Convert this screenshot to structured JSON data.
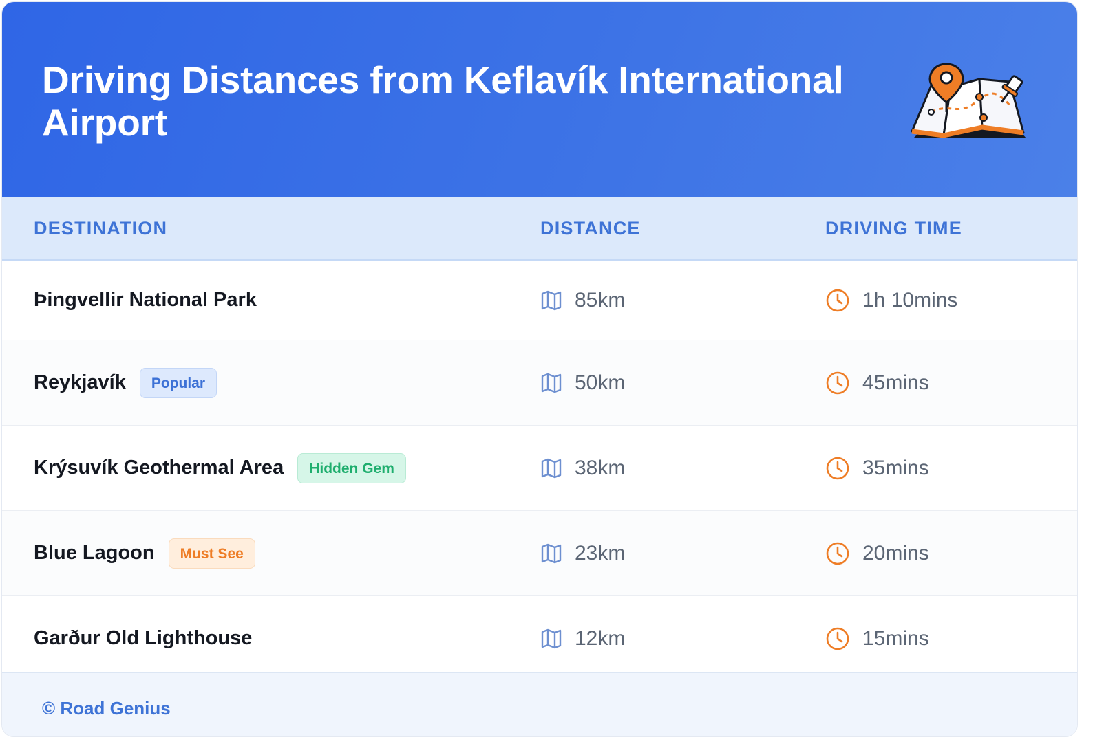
{
  "header": {
    "title": "Driving Distances from Keflavík International Airport",
    "illustration": "map-with-pins-icon"
  },
  "columns": {
    "destination": "DESTINATION",
    "distance": "DISTANCE",
    "driving_time": "DRIVING TIME"
  },
  "rows": [
    {
      "destination": "Þingvellir National Park",
      "badge": "",
      "distance": "85km",
      "time": "1h 10mins"
    },
    {
      "destination": "Reykjavík",
      "badge": "Popular",
      "badge_color": "#3c71d6",
      "distance": "50km",
      "time": "45mins"
    },
    {
      "destination": "Krýsuvík Geothermal Area",
      "badge": "Hidden Gem",
      "badge_color": "#1fae6e",
      "distance": "38km",
      "time": "35mins"
    },
    {
      "destination": "Blue Lagoon",
      "badge": "Must See",
      "badge_color": "#ee7d26",
      "distance": "23km",
      "time": "20mins"
    },
    {
      "destination": "Garður Old Lighthouse",
      "badge": "",
      "distance": "12km",
      "time": "15mins"
    }
  ],
  "icons": {
    "distance": "map-icon",
    "time": "clock-icon"
  },
  "footer": {
    "credit": "© Road Genius"
  },
  "colors": {
    "header_bg": "#2f66e6",
    "accent_blue": "#3e73d6",
    "accent_orange": "#ee7d26"
  }
}
